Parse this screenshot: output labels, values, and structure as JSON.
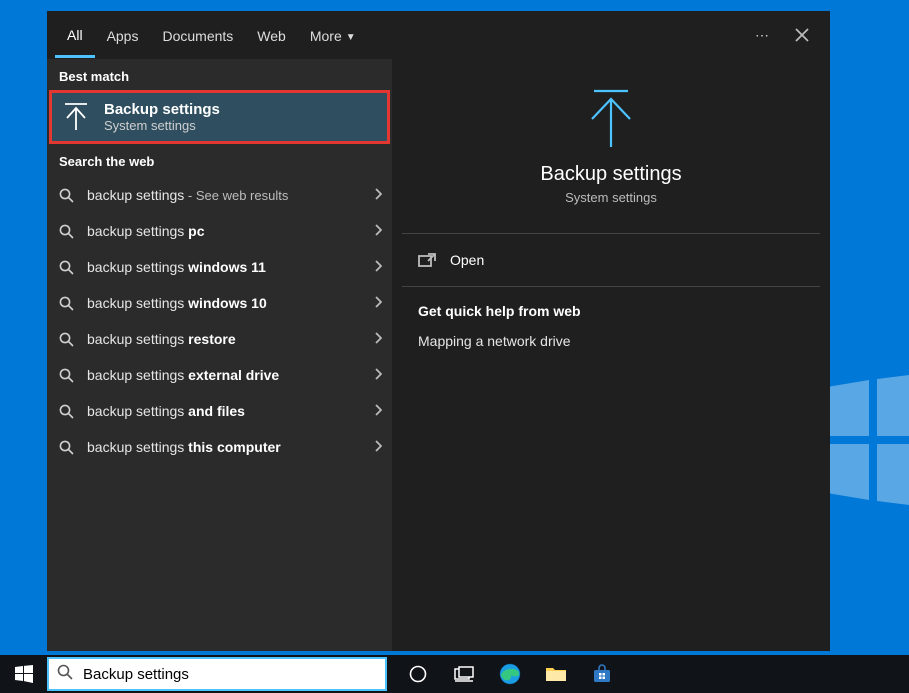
{
  "tabs": {
    "all": "All",
    "apps": "Apps",
    "documents": "Documents",
    "web": "Web",
    "more": "More"
  },
  "sections": {
    "best_match": "Best match",
    "search_web": "Search the web"
  },
  "best_match": {
    "title": "Backup settings",
    "subtitle": "System settings"
  },
  "suggestions": [
    {
      "prefix": "backup settings",
      "bold": "",
      "hint": " - See web results"
    },
    {
      "prefix": "backup settings ",
      "bold": "pc",
      "hint": ""
    },
    {
      "prefix": "backup settings ",
      "bold": "windows 11",
      "hint": ""
    },
    {
      "prefix": "backup settings ",
      "bold": "windows 10",
      "hint": ""
    },
    {
      "prefix": "backup settings ",
      "bold": "restore",
      "hint": ""
    },
    {
      "prefix": "backup settings ",
      "bold": "external drive",
      "hint": ""
    },
    {
      "prefix": "backup settings ",
      "bold": "and files",
      "hint": ""
    },
    {
      "prefix": "backup settings ",
      "bold": "this computer",
      "hint": ""
    }
  ],
  "detail": {
    "title": "Backup settings",
    "subtitle": "System settings",
    "open_label": "Open",
    "help_header": "Get quick help from web",
    "help_links": [
      "Mapping a network drive"
    ]
  },
  "taskbar": {
    "search_value": "Backup settings"
  }
}
